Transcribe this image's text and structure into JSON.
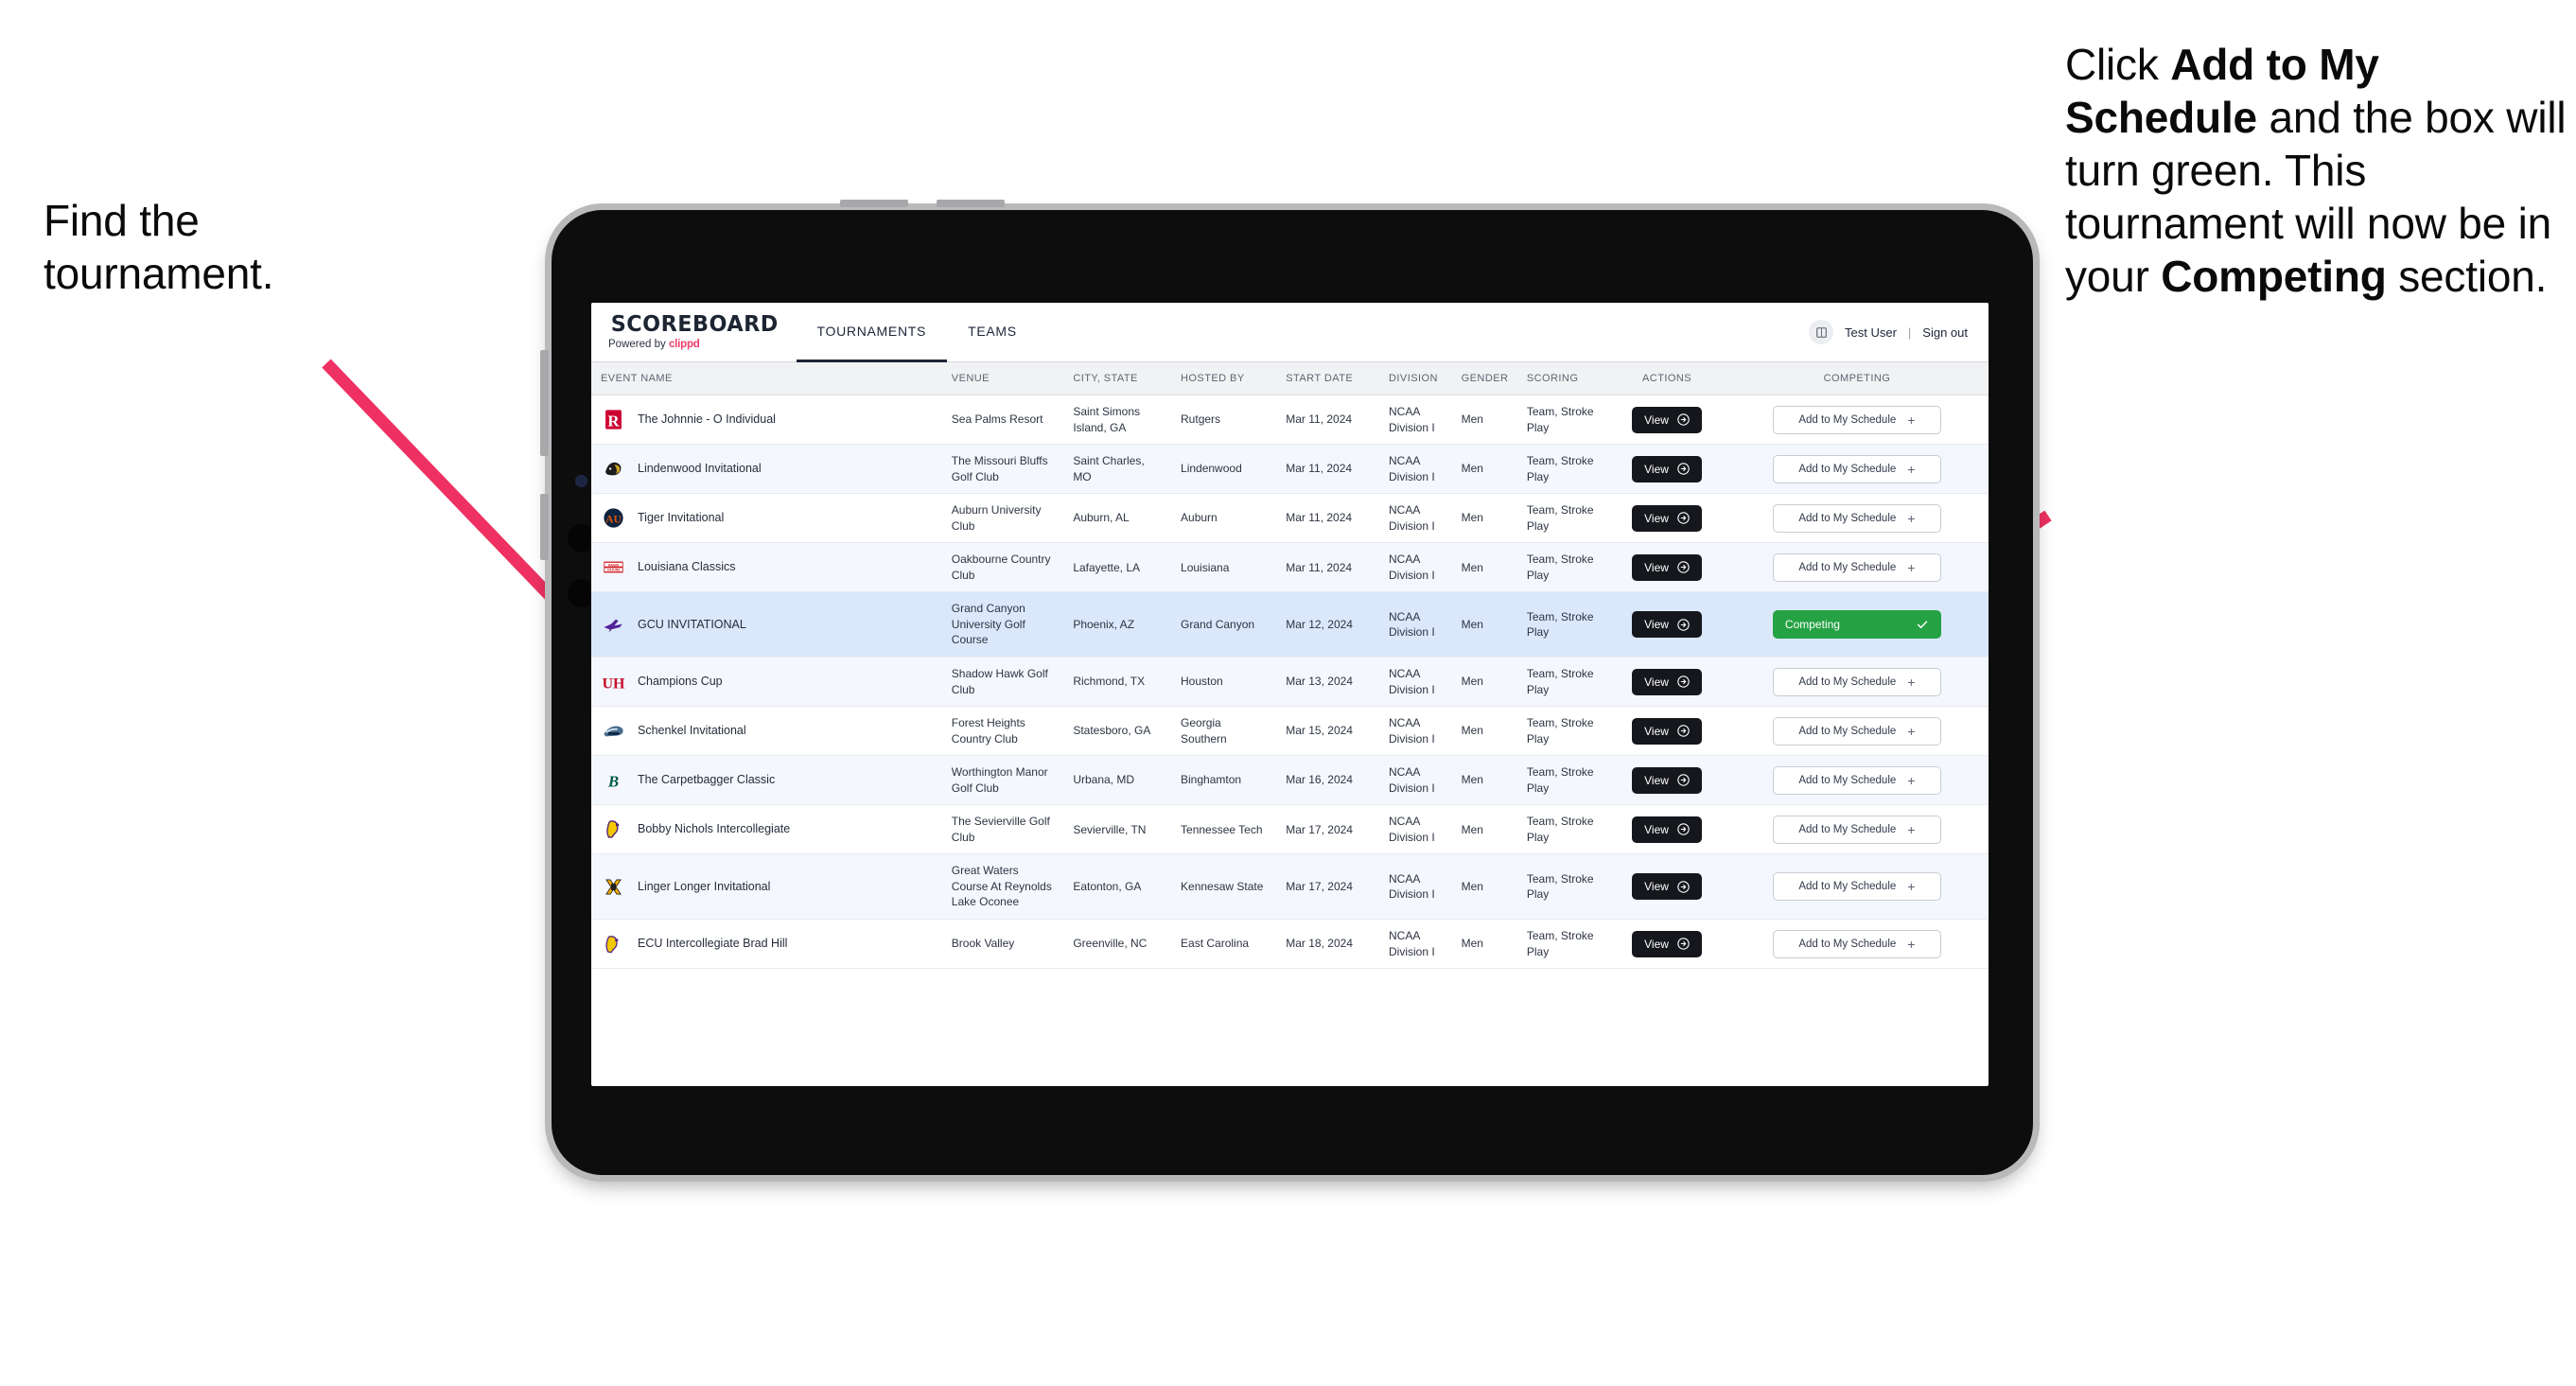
{
  "annotations": {
    "left": {
      "lines": [
        "Find the",
        "tournament."
      ]
    },
    "right": {
      "segments": [
        {
          "text": "Click ",
          "bold": false
        },
        {
          "text": "Add to My Schedule",
          "bold": true
        },
        {
          "text": " and the box will turn green. This tournament will now be in your ",
          "bold": false
        },
        {
          "text": "Competing",
          "bold": true
        },
        {
          "text": " section.",
          "bold": false
        }
      ]
    }
  },
  "app": {
    "brand": {
      "name": "SCOREBOARD",
      "powered_prefix": "Powered by ",
      "powered_brand": "clippd"
    },
    "nav": [
      {
        "label": "TOURNAMENTS",
        "active": true
      },
      {
        "label": "TEAMS",
        "active": false
      }
    ],
    "user": {
      "name": "Test User",
      "separator": "|",
      "signout": "Sign out"
    },
    "table": {
      "columns": [
        {
          "label": "EVENT NAME",
          "align": "left"
        },
        {
          "label": "VENUE",
          "align": "left"
        },
        {
          "label": "CITY, STATE",
          "align": "left"
        },
        {
          "label": "HOSTED BY",
          "align": "left"
        },
        {
          "label": "START DATE",
          "align": "left"
        },
        {
          "label": "DIVISION",
          "align": "left"
        },
        {
          "label": "GENDER",
          "align": "left"
        },
        {
          "label": "SCORING",
          "align": "left"
        },
        {
          "label": "ACTIONS",
          "align": "center"
        },
        {
          "label": "COMPETING",
          "align": "center"
        }
      ],
      "view_label": "View",
      "add_label": "Add to My Schedule",
      "competing_label": "Competing",
      "rows": [
        {
          "logo": "rutgers-logo",
          "event": "The Johnnie - O Individual",
          "venue": "Sea Palms Resort",
          "city": "Saint Simons Island, GA",
          "host": "Rutgers",
          "date": "Mar 11, 2024",
          "division": "NCAA Division I",
          "gender": "Men",
          "scoring": "Team, Stroke Play",
          "competing": false
        },
        {
          "logo": "lindenwood-logo",
          "event": "Lindenwood Invitational",
          "venue": "The Missouri Bluffs Golf Club",
          "city": "Saint Charles, MO",
          "host": "Lindenwood",
          "date": "Mar 11, 2024",
          "division": "NCAA Division I",
          "gender": "Men",
          "scoring": "Team, Stroke Play",
          "competing": false
        },
        {
          "logo": "auburn-logo",
          "event": "Tiger Invitational",
          "venue": "Auburn University Club",
          "city": "Auburn, AL",
          "host": "Auburn",
          "date": "Mar 11, 2024",
          "division": "NCAA Division I",
          "gender": "Men",
          "scoring": "Team, Stroke Play",
          "competing": false
        },
        {
          "logo": "louisiana-logo",
          "event": "Louisiana Classics",
          "venue": "Oakbourne Country Club",
          "city": "Lafayette, LA",
          "host": "Louisiana",
          "date": "Mar 11, 2024",
          "division": "NCAA Division I",
          "gender": "Men",
          "scoring": "Team, Stroke Play",
          "competing": false
        },
        {
          "logo": "gcu-logo",
          "event": "GCU INVITATIONAL",
          "venue": "Grand Canyon University Golf Course",
          "city": "Phoenix, AZ",
          "host": "Grand Canyon",
          "date": "Mar 12, 2024",
          "division": "NCAA Division I",
          "gender": "Men",
          "scoring": "Team, Stroke Play",
          "competing": true
        },
        {
          "logo": "houston-logo",
          "event": "Champions Cup",
          "venue": "Shadow Hawk Golf Club",
          "city": "Richmond, TX",
          "host": "Houston",
          "date": "Mar 13, 2024",
          "division": "NCAA Division I",
          "gender": "Men",
          "scoring": "Team, Stroke Play",
          "competing": false
        },
        {
          "logo": "georgiasouth-logo",
          "event": "Schenkel Invitational",
          "venue": "Forest Heights Country Club",
          "city": "Statesboro, GA",
          "host": "Georgia Southern",
          "date": "Mar 15, 2024",
          "division": "NCAA Division I",
          "gender": "Men",
          "scoring": "Team, Stroke Play",
          "competing": false
        },
        {
          "logo": "binghamton-logo",
          "event": "The Carpetbagger Classic",
          "venue": "Worthington Manor Golf Club",
          "city": "Urbana, MD",
          "host": "Binghamton",
          "date": "Mar 16, 2024",
          "division": "NCAA Division I",
          "gender": "Men",
          "scoring": "Team, Stroke Play",
          "competing": false
        },
        {
          "logo": "tntech-logo",
          "event": "Bobby Nichols Intercollegiate",
          "venue": "The Sevierville Golf Club",
          "city": "Sevierville, TN",
          "host": "Tennessee Tech",
          "date": "Mar 17, 2024",
          "division": "NCAA Division I",
          "gender": "Men",
          "scoring": "Team, Stroke Play",
          "competing": false
        },
        {
          "logo": "kennesaw-logo",
          "event": "Linger Longer Invitational",
          "venue": "Great Waters Course At Reynolds Lake Oconee",
          "city": "Eatonton, GA",
          "host": "Kennesaw State",
          "date": "Mar 17, 2024",
          "division": "NCAA Division I",
          "gender": "Men",
          "scoring": "Team, Stroke Play",
          "competing": false
        },
        {
          "logo": "ecu-logo",
          "event": "ECU Intercollegiate Brad Hill",
          "venue": "Brook Valley",
          "city": "Greenville, NC",
          "host": "East Carolina",
          "date": "Mar 18, 2024",
          "division": "NCAA Division I",
          "gender": "Men",
          "scoring": "Team, Stroke Play",
          "competing": false
        }
      ]
    }
  },
  "colors": {
    "accent_pink": "#ee3162",
    "competing_green": "#25a244",
    "selected_row": "#dbe8fb",
    "dark_button": "#15171c"
  }
}
